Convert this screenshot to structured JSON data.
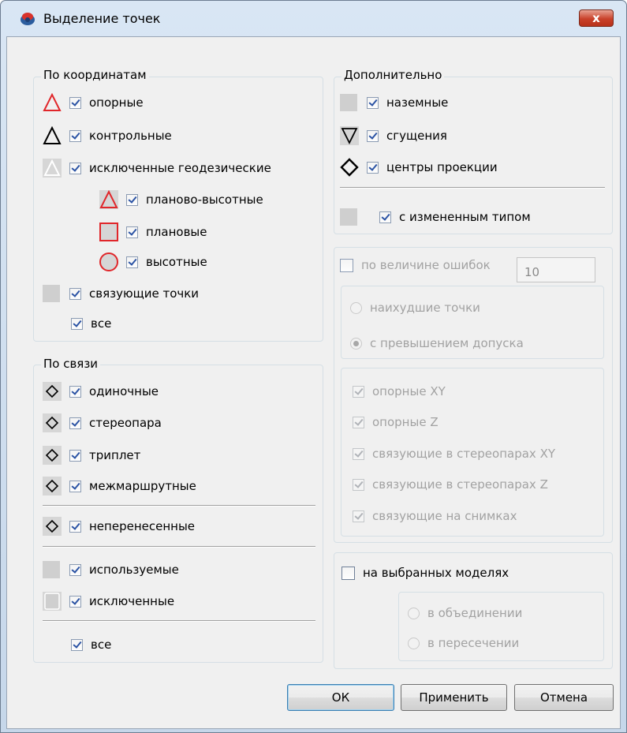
{
  "window": {
    "title": "Выделение точек",
    "close_label": "x"
  },
  "by_coordinates": {
    "label": "По координатам",
    "items": [
      {
        "label": "опорные",
        "checked": true
      },
      {
        "label": "контрольные",
        "checked": true
      },
      {
        "label": "исключенные геодезические",
        "checked": true
      },
      {
        "label": "планово-высотные",
        "checked": true
      },
      {
        "label": "плановые",
        "checked": true
      },
      {
        "label": "высотные",
        "checked": true
      },
      {
        "label": "связующие точки",
        "checked": true
      },
      {
        "label": "все",
        "checked": true
      }
    ]
  },
  "by_link": {
    "label": "По связи",
    "items": [
      {
        "label": "одиночные",
        "checked": true
      },
      {
        "label": "стереопара",
        "checked": true
      },
      {
        "label": "триплет",
        "checked": true
      },
      {
        "label": "межмаршрутные",
        "checked": true
      },
      {
        "label": "неперенесенные",
        "checked": true
      },
      {
        "label": "используемые",
        "checked": true
      },
      {
        "label": "исключенные",
        "checked": true
      },
      {
        "label": "все",
        "checked": true
      }
    ]
  },
  "additional": {
    "label": "Дополнительно",
    "items": [
      {
        "label": "наземные",
        "checked": true
      },
      {
        "label": "сгущения",
        "checked": true
      },
      {
        "label": "центры проекции",
        "checked": true
      },
      {
        "label": "с измененным типом",
        "checked": true
      }
    ]
  },
  "errors": {
    "label": "по величине ошибок",
    "checked": false,
    "worst_label": "наихудшие точки",
    "worst_value": "10",
    "tolerance_label": "с превышением допуска",
    "items": [
      {
        "label": "опорные XY",
        "checked": true
      },
      {
        "label": "опорные Z",
        "checked": true
      },
      {
        "label": "связующие в стереопарах XY",
        "checked": true
      },
      {
        "label": "связующие в стереопарах Z",
        "checked": true
      },
      {
        "label": "связующие на снимках",
        "checked": true
      }
    ]
  },
  "models": {
    "label": "на выбранных моделях",
    "checked": false,
    "union_label": "в объединении",
    "intersection_label": "в пересечении"
  },
  "buttons": {
    "ok": "ОК",
    "apply": "Применить",
    "cancel": "Отмена"
  },
  "colors": {
    "accent_red": "#e0262a",
    "check_blue": "#2b53a4",
    "disabled_text": "#a2a2a2"
  }
}
